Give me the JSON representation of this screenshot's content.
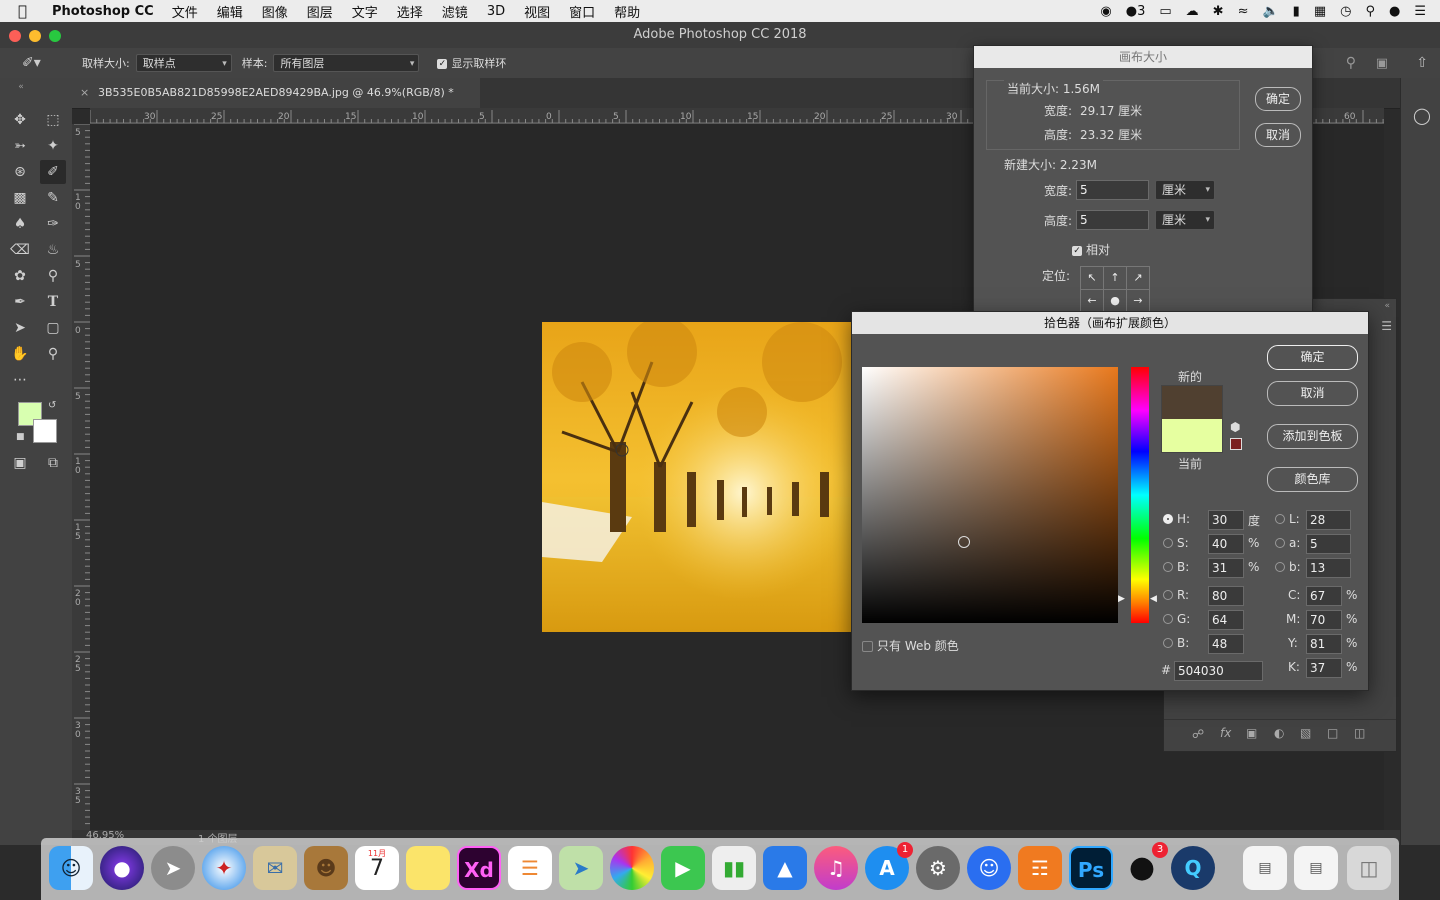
{
  "menubar": {
    "app_name": "Photoshop CC",
    "items": [
      "文件",
      "编辑",
      "图像",
      "图层",
      "文字",
      "选择",
      "滤镜",
      "3D",
      "视图",
      "窗口",
      "帮助"
    ],
    "qq_badge": "3"
  },
  "window": {
    "title": "Adobe Photoshop CC 2018"
  },
  "options_bar": {
    "sample_size_label": "取样大小:",
    "sample_size_value": "取样点",
    "sample_label": "样本:",
    "sample_value": "所有图层",
    "show_ring_label": "显示取样环"
  },
  "document_tab": {
    "title": "3B535E0B5AB821D85998E2AED89429BA.jpg @ 46.9%(RGB/8) *"
  },
  "ruler": {
    "h_labels": [
      "30",
      "25",
      "20",
      "15",
      "10",
      "5",
      "0",
      "5",
      "10",
      "15",
      "20",
      "25",
      "30",
      "60"
    ],
    "v_labels": [
      "5",
      "1 0",
      "5",
      "0",
      "5",
      "1 0",
      "1 5",
      "2 0",
      "2 5",
      "3 0",
      "3 5"
    ]
  },
  "status_bar": {
    "zoom": "46.95%",
    "layers": "1 个图层"
  },
  "canvas_dialog": {
    "title": "画布大小",
    "current_size": "当前大小: 1.56M",
    "width_label": "宽度:",
    "current_width": "29.17 厘米",
    "height_label": "高度:",
    "current_height": "23.32 厘米",
    "new_size": "新建大小: 2.23M",
    "new_width": "5",
    "new_height": "5",
    "unit": "厘米",
    "relative_label": "相对",
    "anchor_label": "定位:",
    "ok": "确定",
    "cancel": "取消"
  },
  "color_picker": {
    "title": "拾色器（画布扩展颜色）",
    "ok": "确定",
    "cancel": "取消",
    "add_swatch": "添加到色板",
    "color_library": "颜色库",
    "new_label": "新的",
    "current_label": "当前",
    "new_color": "#504030",
    "current_color": "#e6ffa0",
    "web_only_label": "只有 Web 颜色",
    "fields": {
      "H": "30",
      "H_unit": "度",
      "S": "40",
      "S_unit": "%",
      "Bv": "31",
      "Bv_unit": "%",
      "R": "80",
      "G": "64",
      "Bl": "48",
      "L": "28",
      "a": "5",
      "b": "13",
      "C": "67",
      "M": "70",
      "Y": "81",
      "K": "37",
      "pct": "%",
      "hex": "504030"
    },
    "labels": {
      "H": "H:",
      "S": "S:",
      "Bv": "B:",
      "R": "R:",
      "G": "G:",
      "Bl": "B:",
      "L": "L:",
      "a": "a:",
      "b": "b:",
      "C": "C:",
      "M": "M:",
      "Y": "Y:",
      "K": "K:",
      "hash": "#"
    }
  },
  "dock": {
    "appstore_badge": "1",
    "qq_badge": "3",
    "calendar_month": "11月",
    "calendar_day": "7",
    "xd_label": "Xd",
    "ps_label": "Ps"
  }
}
